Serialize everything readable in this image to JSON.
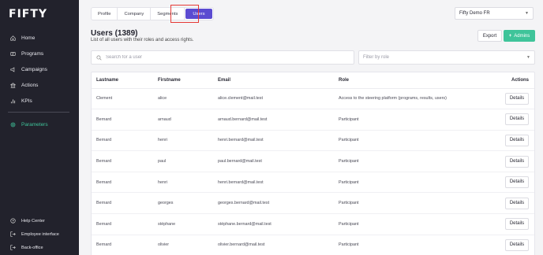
{
  "app": {
    "logo": "FIFTY"
  },
  "sidebar": {
    "items": [
      {
        "label": "Home",
        "icon": "home-icon"
      },
      {
        "label": "Programs",
        "icon": "programs-icon"
      },
      {
        "label": "Campaigns",
        "icon": "campaigns-icon"
      },
      {
        "label": "Actions",
        "icon": "actions-icon"
      },
      {
        "label": "KPIs",
        "icon": "kpis-icon"
      }
    ],
    "active_item": {
      "label": "Parameters",
      "icon": "gear-icon"
    },
    "bottom": [
      {
        "label": "Help Center",
        "icon": "help-icon"
      },
      {
        "label": "Employee interface",
        "icon": "switch-interface-icon"
      },
      {
        "label": "Back-office",
        "icon": "back-office-icon"
      }
    ],
    "accent_color": "#3fc49a"
  },
  "tabs": [
    {
      "label": "Profile"
    },
    {
      "label": "Company"
    },
    {
      "label": "Segments"
    },
    {
      "label": "Users"
    }
  ],
  "active_tab": "Users",
  "org_select": {
    "value": "Fifty Demo FR"
  },
  "header": {
    "title": "Users (1389)",
    "subtitle": "List of all users with their roles and access rights.",
    "export_label": "Export",
    "admins_label": "Admins"
  },
  "search": {
    "placeholder": "Search for a user",
    "value": ""
  },
  "role_filter": {
    "placeholder": "Filter by role"
  },
  "table": {
    "columns": [
      "Lastname",
      "Firstname",
      "Email",
      "Role",
      "Actions"
    ],
    "action_label": "Details",
    "rows": [
      [
        "Clement",
        "alice",
        "alice.clement@mail.test",
        "Access to the steering platform (programs, results, users)"
      ],
      [
        "Bernard",
        "arnaud",
        "arnaud.bernard@mail.test",
        "Participant"
      ],
      [
        "Bernard",
        "henri",
        "henri.bernard@mail.test",
        "Participant"
      ],
      [
        "Bernard",
        "paul",
        "paul.bernard@mail.test",
        "Participant"
      ],
      [
        "Bernard",
        "henri",
        "henri.bernard@mail.test",
        "Participant"
      ],
      [
        "Bernard",
        "georges",
        "georges.bernard@mail.test",
        "Participant"
      ],
      [
        "Bernard",
        "stéphane",
        "stéphane.bernard@mail.test",
        "Participant"
      ],
      [
        "Bernard",
        "olivier",
        "olivier.bernard@mail.test",
        "Participant"
      ]
    ]
  },
  "colors": {
    "primary": "#5b4bd1",
    "accent": "#3fc49a",
    "sidebar_bg": "#22222c",
    "highlight": "#e53935"
  }
}
